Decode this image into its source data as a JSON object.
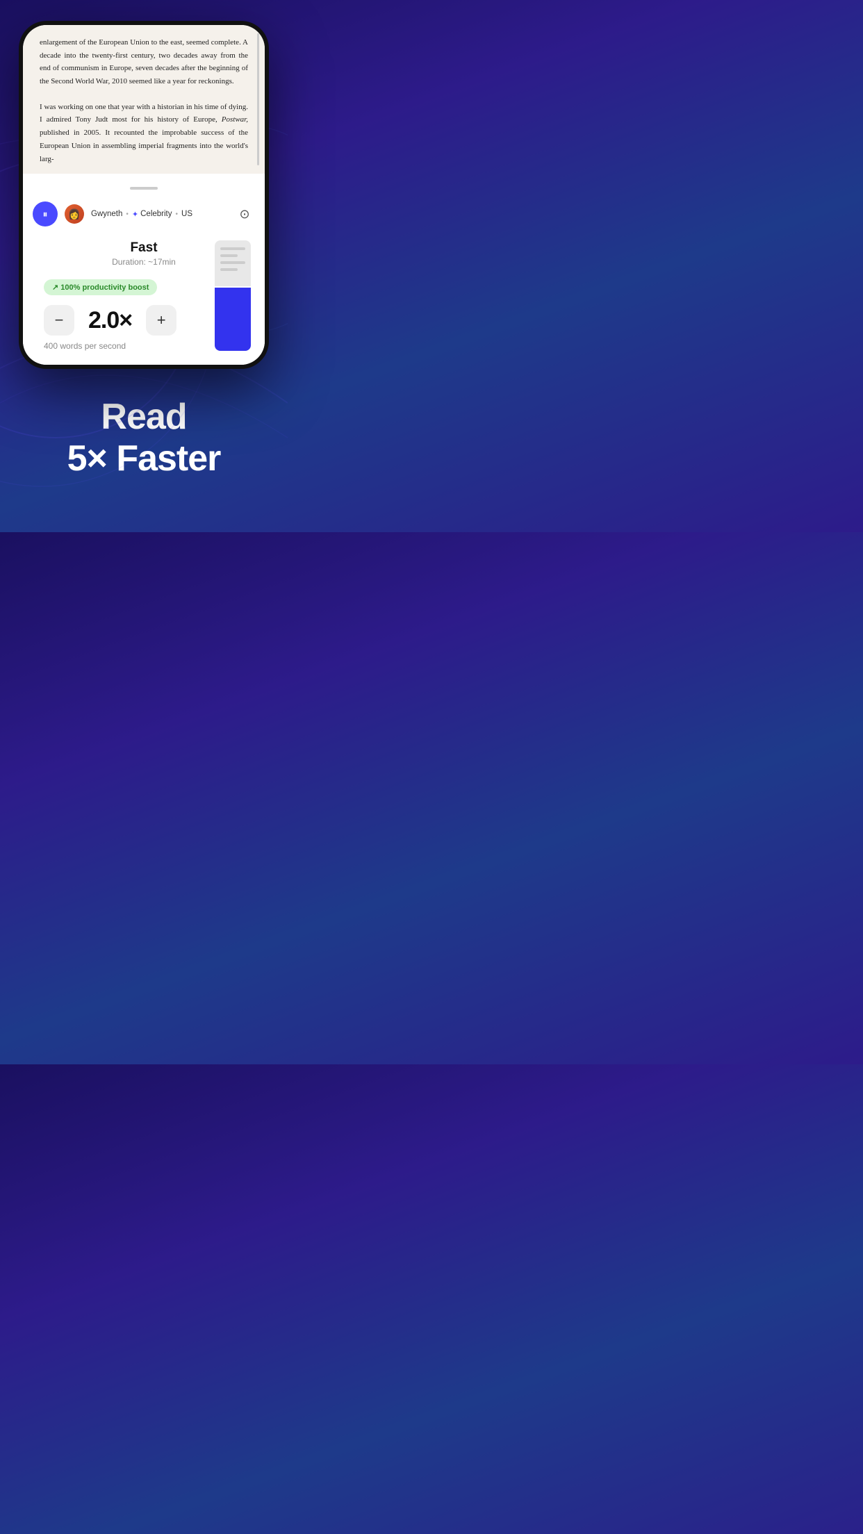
{
  "background": {
    "gradient_start": "#1a1060",
    "gradient_end": "#1e3a8a"
  },
  "phone": {
    "book_text": {
      "paragraph1": "enlargement of the European Union to the east, seemed complete. A decade into the twenty-first century, two decades away from the end of communism in Europe, seven decades after the beginning of the Second World War, 2010 seemed like a year for reckonings.",
      "paragraph2": "I was working on one that year with a historian in his time of dying. I admired Tony Judt most for his history of Europe, Postwar, published in 2005. It recounted the improbable success of the European Union in assembling imperial fragments into the world's larg-"
    },
    "playback_bar": {
      "voice_emoji": "👩",
      "voice_name": "Gwyneth",
      "separator": "•",
      "celebrity_icon": "✦",
      "celebrity_label": "Celebrity",
      "region": "US",
      "pause_label": "pause"
    },
    "speed_panel": {
      "speed_name": "Fast",
      "duration_label": "Duration: ~17min",
      "productivity_boost": "↗ 100% productivity boost",
      "speed_value": "2.0×",
      "words_per_second": "400 words per second",
      "minus_label": "−",
      "plus_label": "+"
    },
    "slider": {
      "upper_color": "#e8e8e8",
      "lower_color": "#3333ee"
    }
  },
  "tagline": {
    "line1": "Read",
    "line2": "5× Faster"
  }
}
